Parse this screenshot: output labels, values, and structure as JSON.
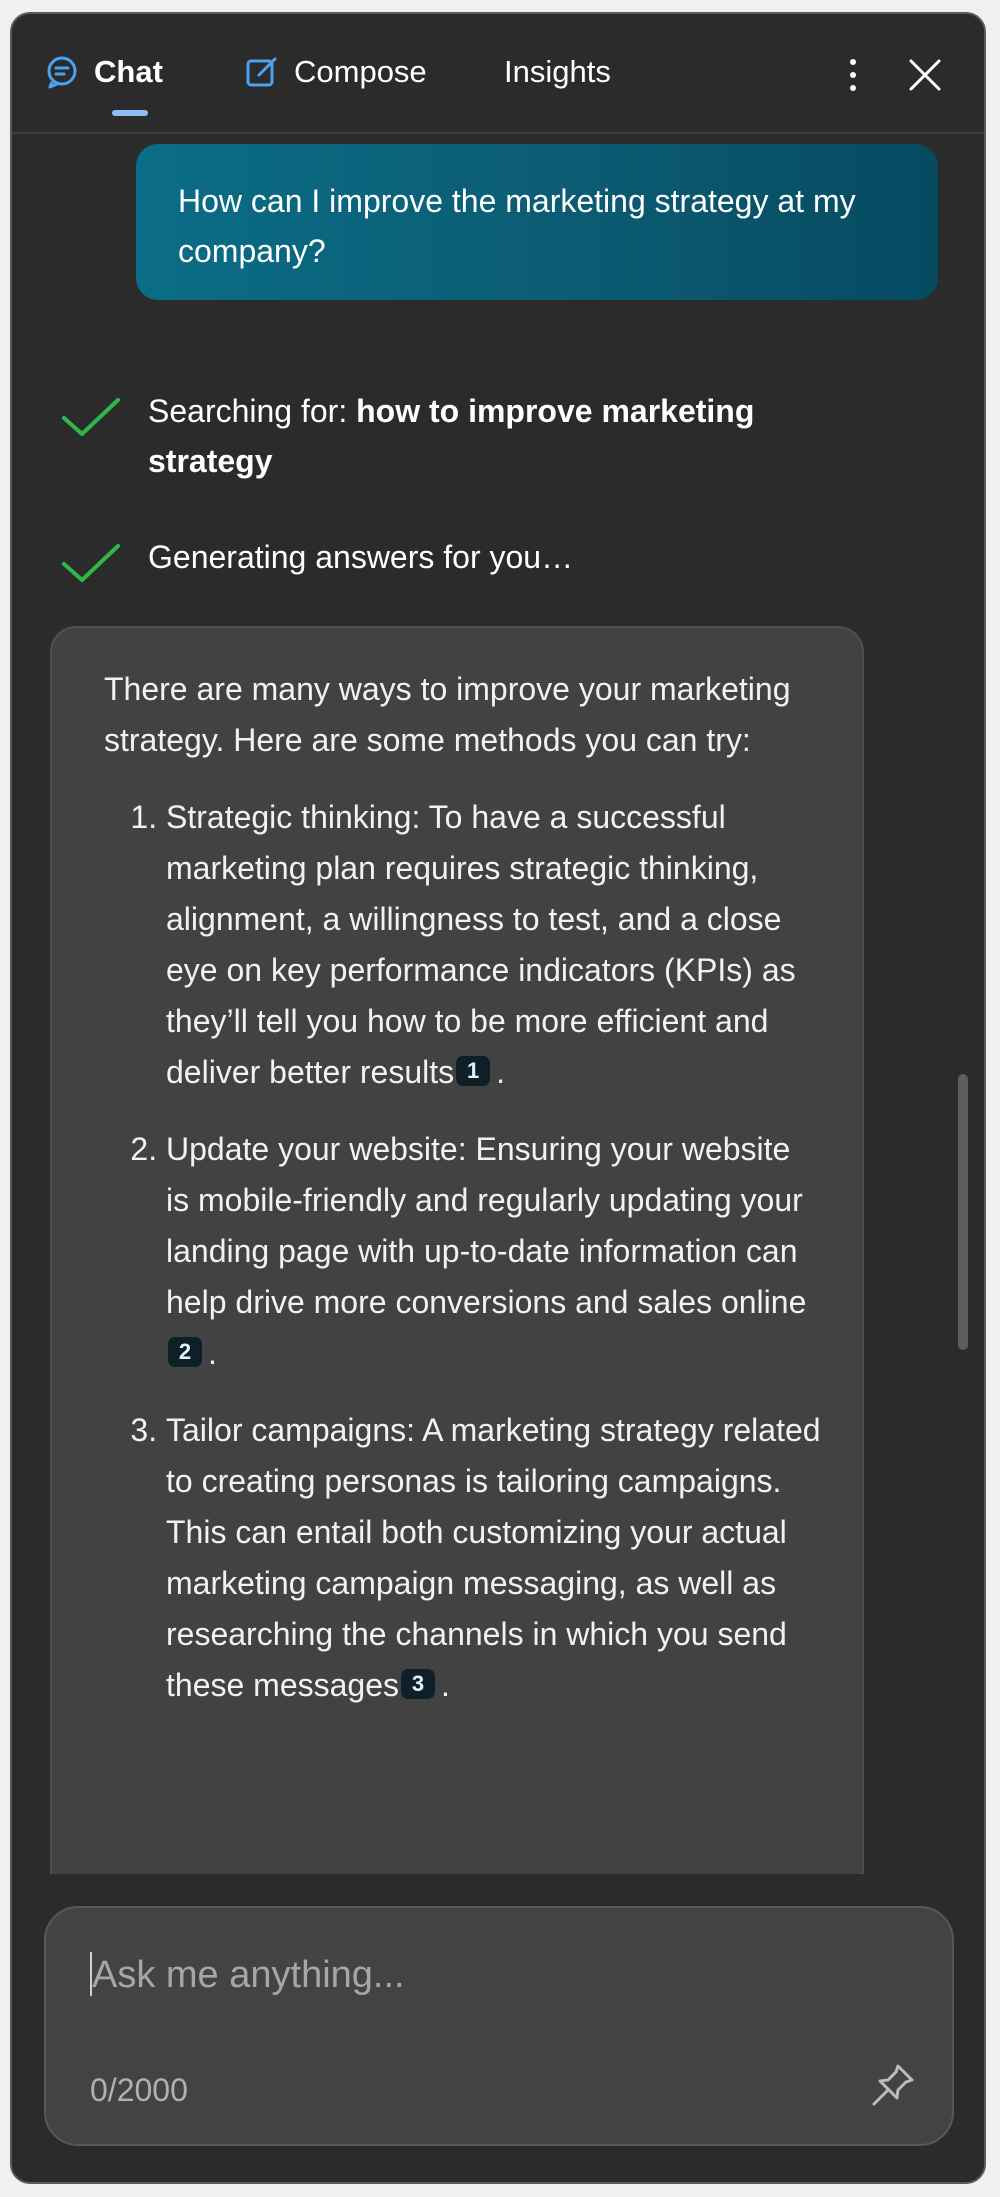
{
  "tabs": [
    {
      "label": "Chat",
      "icon": "chat-bubble-icon",
      "active": true
    },
    {
      "label": "Compose",
      "icon": "compose-icon"
    },
    {
      "label": "Insights"
    }
  ],
  "header_icons": {
    "more": "more-vertical-icon",
    "close": "close-icon"
  },
  "user_message": "How can I improve the marketing strategy at my company?",
  "status": [
    {
      "prefix": "Searching for: ",
      "query": "how to improve marketing strategy",
      "icon": "checkmark-icon"
    },
    {
      "text": "Generating answers for you…",
      "icon": "checkmark-icon"
    }
  ],
  "answer": {
    "intro": "There are many ways to improve your marketing strategy. Here are some methods you can try:",
    "items": [
      {
        "text": "Strategic thinking: To have a successful marketing plan requires strategic thinking, alignment, a willingness to test, and a close eye on key performance indicators (KPIs) as they’ll tell you how to be more efficient and deliver better results",
        "cite": "1",
        "end": "."
      },
      {
        "text": "Update your website: Ensuring your website is mobile-friendly and regularly updating your landing page with up-to-date information can help drive more conversions and sales online",
        "cite": "2",
        "end": "."
      },
      {
        "text": "Tailor campaigns: A marketing strategy related to creating personas is tailoring campaigns. This can entail both customizing your actual marketing campaign messaging, as well as researching the channels in which you send these messages",
        "cite": "3",
        "end": "."
      }
    ]
  },
  "composer": {
    "placeholder": "Ask me anything...",
    "value": "",
    "char_count": "0/2000",
    "pin_icon": "pin-icon"
  },
  "colors": {
    "background": "#2b2b2b",
    "user_bubble": "#0b6d87",
    "answer_bubble": "#424242",
    "check_green": "#2fb84a",
    "accent_blue": "#4aa3f0"
  }
}
